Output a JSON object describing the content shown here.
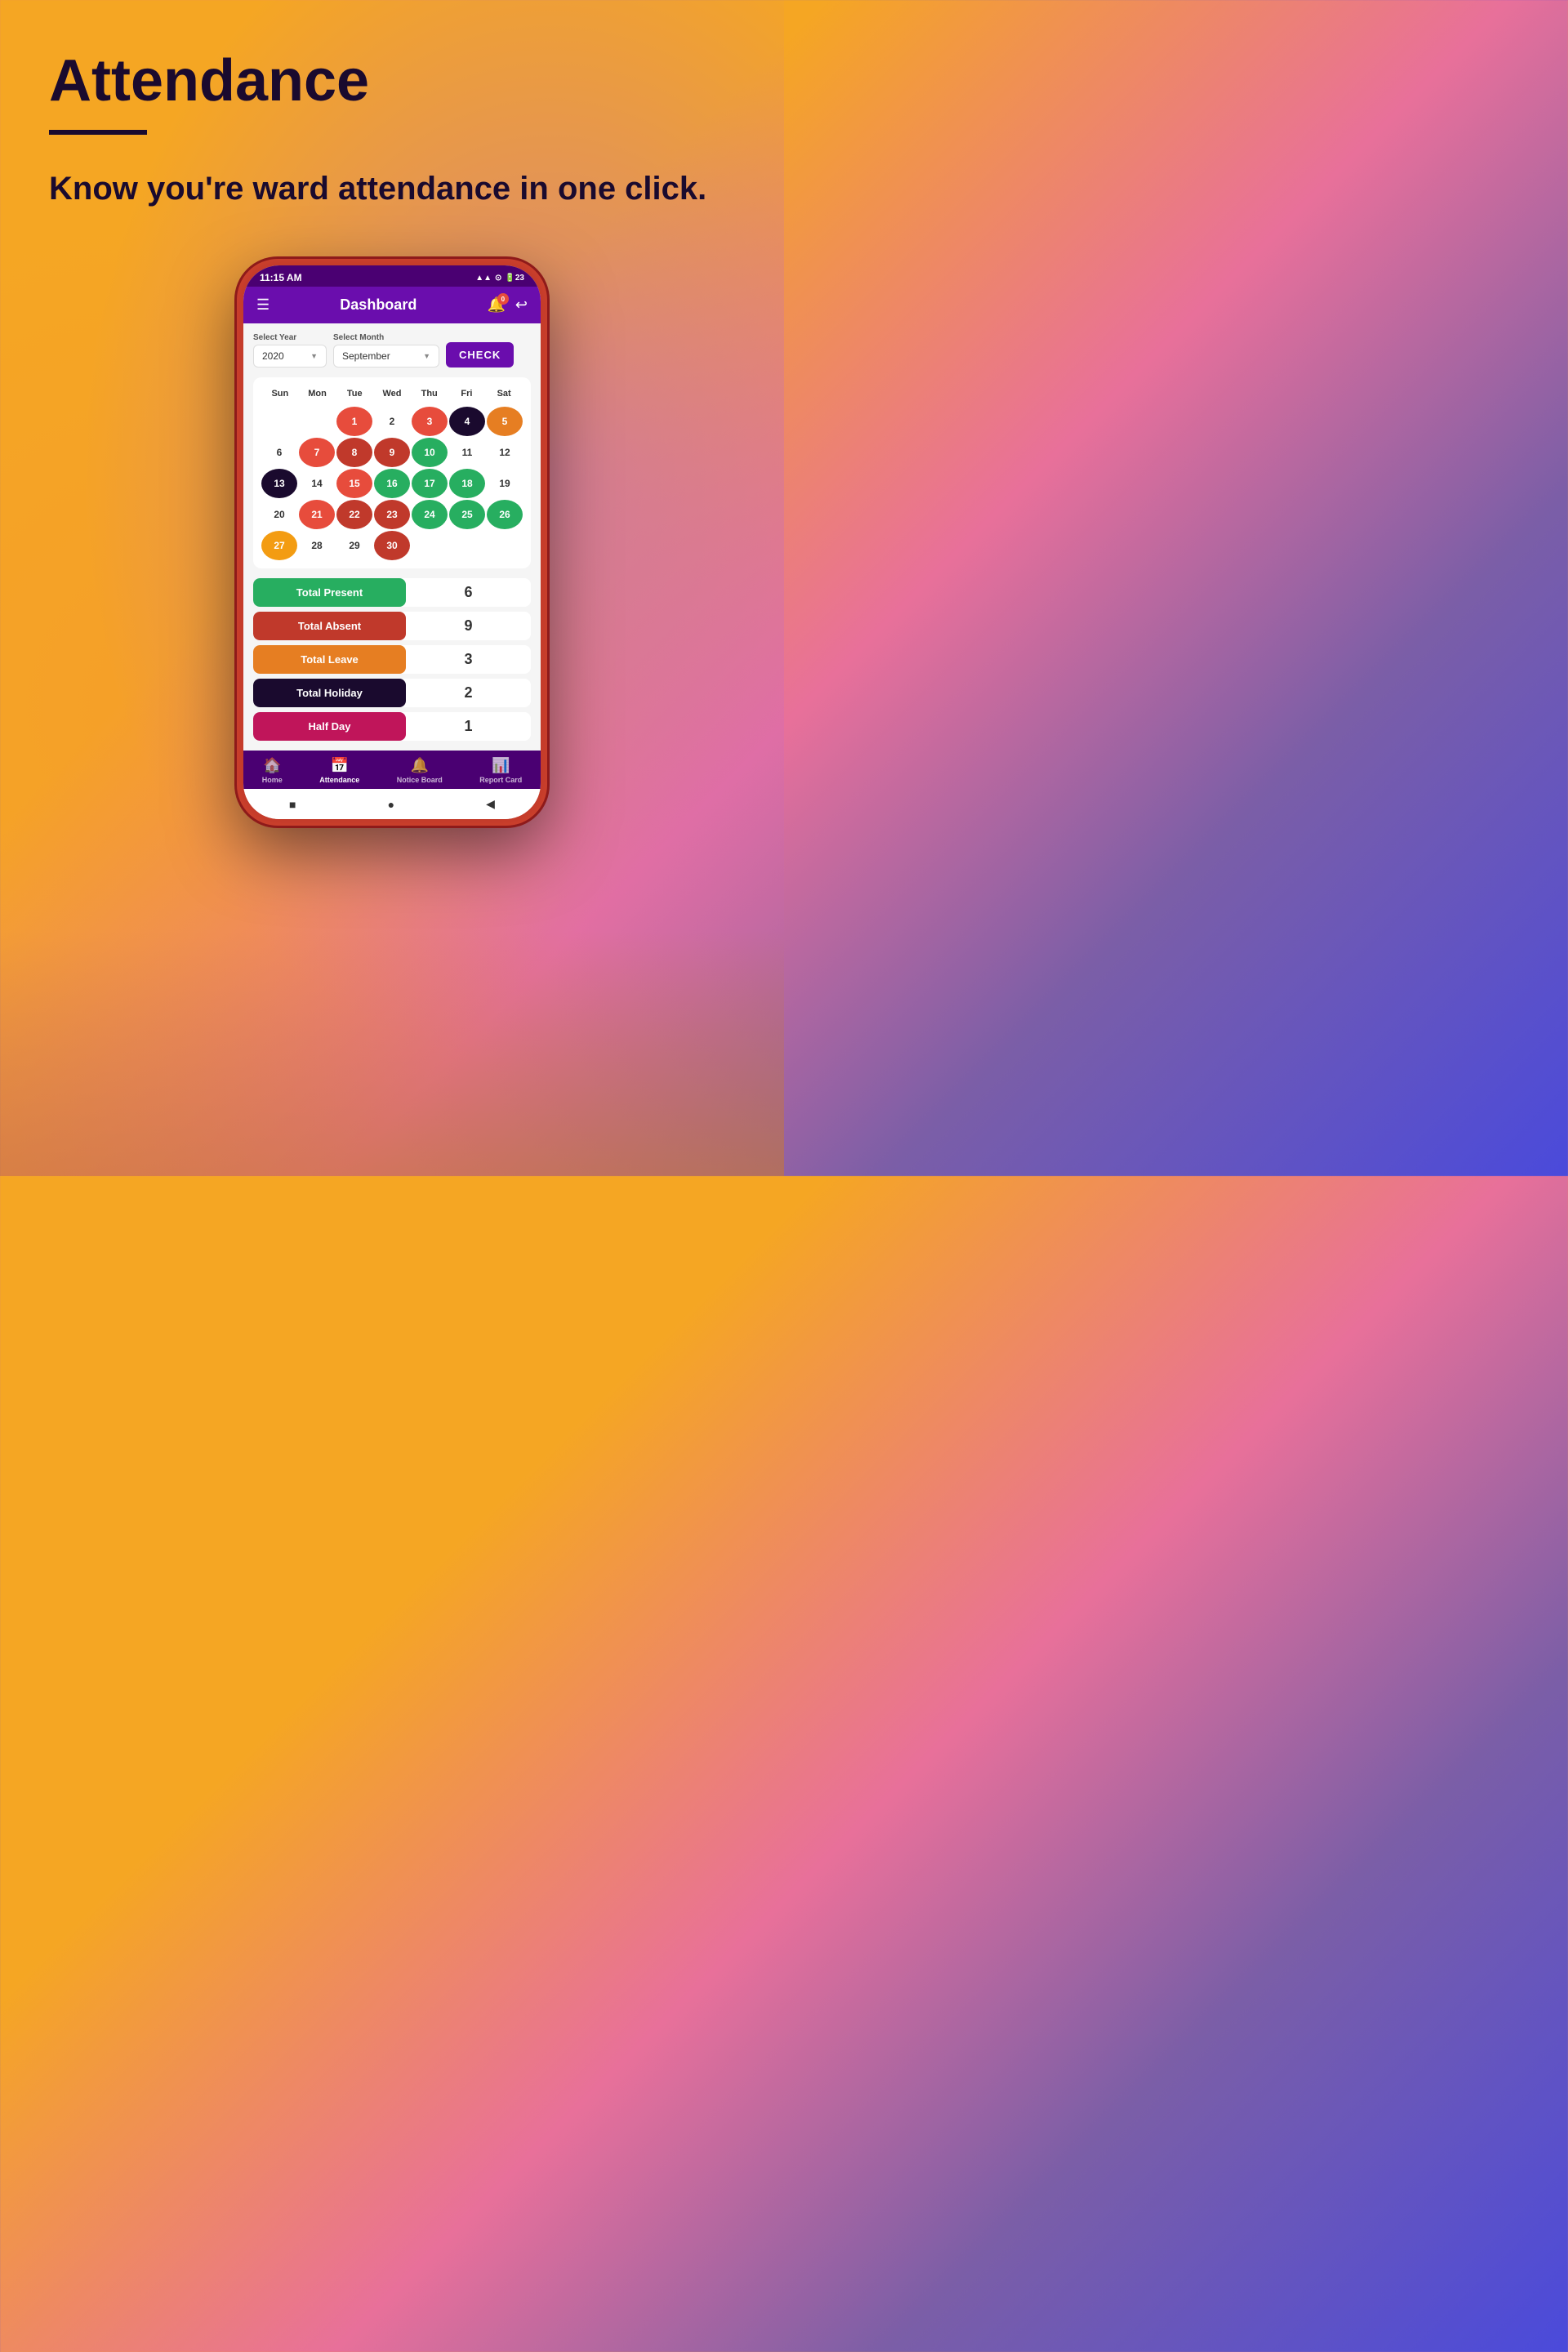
{
  "hero": {
    "title": "Attendance",
    "subtitle": "Know you're ward attendance in one click.",
    "divider_color": "#1a0a2e"
  },
  "status_bar": {
    "time": "11:15 AM",
    "icons": "▲▲ ⓦ 23"
  },
  "header": {
    "menu_icon": "☰",
    "title": "Dashboard",
    "notification_count": "0",
    "back_icon": "↩"
  },
  "selectors": {
    "year_label": "Select Year",
    "year_value": "2020",
    "month_label": "Select Month",
    "month_value": "September",
    "check_button": "CHECK"
  },
  "calendar": {
    "day_labels": [
      "Sun",
      "Mon",
      "Tue",
      "Wed",
      "Thu",
      "Fri",
      "Sat"
    ],
    "weeks": [
      [
        {
          "day": "",
          "type": "empty"
        },
        {
          "day": "",
          "type": "empty"
        },
        {
          "day": "1",
          "type": "red"
        },
        {
          "day": "2",
          "type": "plain"
        },
        {
          "day": "3",
          "type": "red"
        },
        {
          "day": "4",
          "type": "black"
        },
        {
          "day": "5",
          "type": "orange-red"
        }
      ],
      [
        {
          "day": "6",
          "type": "plain"
        },
        {
          "day": "7",
          "type": "red"
        },
        {
          "day": "8",
          "type": "dark-red"
        },
        {
          "day": "9",
          "type": "dark-red"
        },
        {
          "day": "10",
          "type": "green"
        },
        {
          "day": "11",
          "type": "plain"
        },
        {
          "day": "12",
          "type": "plain"
        }
      ],
      [
        {
          "day": "13",
          "type": "black"
        },
        {
          "day": "14",
          "type": "plain"
        },
        {
          "day": "15",
          "type": "red"
        },
        {
          "day": "16",
          "type": "green"
        },
        {
          "day": "17",
          "type": "green"
        },
        {
          "day": "18",
          "type": "green"
        },
        {
          "day": "19",
          "type": "plain"
        }
      ],
      [
        {
          "day": "20",
          "type": "plain"
        },
        {
          "day": "21",
          "type": "red"
        },
        {
          "day": "22",
          "type": "dark-red"
        },
        {
          "day": "23",
          "type": "dark-red"
        },
        {
          "day": "24",
          "type": "green"
        },
        {
          "day": "25",
          "type": "green"
        },
        {
          "day": "26",
          "type": "green"
        }
      ],
      [
        {
          "day": "27",
          "type": "orange"
        },
        {
          "day": "28",
          "type": "plain"
        },
        {
          "day": "29",
          "type": "plain"
        },
        {
          "day": "30",
          "type": "dark-red"
        },
        {
          "day": "",
          "type": "empty"
        },
        {
          "day": "",
          "type": "empty"
        },
        {
          "day": "",
          "type": "empty"
        }
      ]
    ]
  },
  "stats": [
    {
      "label": "Total Present",
      "value": "6",
      "class": "present"
    },
    {
      "label": "Total Absent",
      "value": "9",
      "class": "absent"
    },
    {
      "label": "Total Leave",
      "value": "3",
      "class": "leave"
    },
    {
      "label": "Total Holiday",
      "value": "2",
      "class": "holiday"
    },
    {
      "label": "Half Day",
      "value": "1",
      "class": "halfday"
    }
  ],
  "bottom_nav": [
    {
      "icon": "🏠",
      "label": "Home",
      "active": false
    },
    {
      "icon": "📅",
      "label": "Attendance",
      "active": true
    },
    {
      "icon": "🔔",
      "label": "Notice Board",
      "active": false
    },
    {
      "icon": "📊",
      "label": "Report Card",
      "active": false
    }
  ],
  "system_nav": [
    "■",
    "●",
    "◀"
  ]
}
